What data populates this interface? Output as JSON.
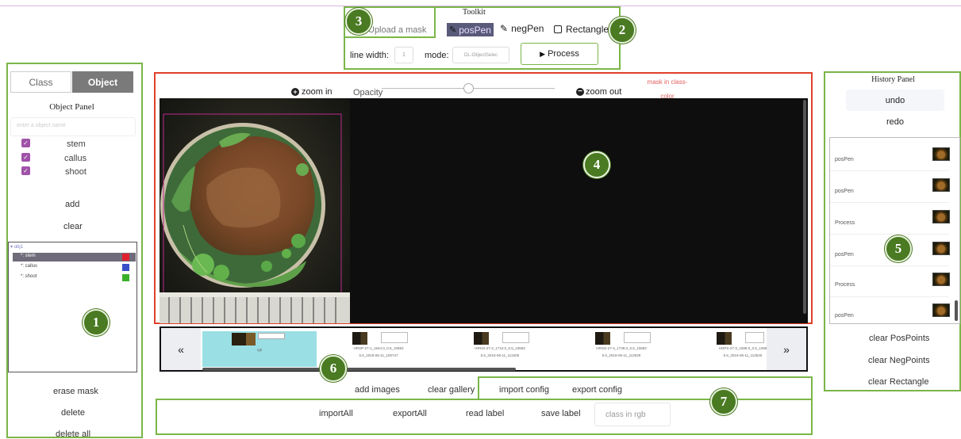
{
  "toolkit": {
    "title": "Toolkit",
    "upload_mask": "Upload a mask",
    "pos_pen": "posPen",
    "neg_pen": "negPen",
    "rectangle": "Rectangle",
    "line_width_label": "line width:",
    "line_width_value": "1",
    "mode_label": "mode:",
    "mode_value": "DL-ObjectSelec",
    "process": "Process"
  },
  "left_panel": {
    "tabs": [
      "Class",
      "Object"
    ],
    "active_tab": "Object",
    "panel_title": "Object Panel",
    "name_placeholder": "enter a object name",
    "classes": [
      {
        "label": "stem",
        "checked": true
      },
      {
        "label": "callus",
        "checked": true
      },
      {
        "label": "shoot",
        "checked": true
      }
    ],
    "add": "add",
    "clear": "clear",
    "tree": {
      "root": "obj1",
      "items": [
        {
          "label": "*: stem",
          "color": "#e0202e",
          "selected": true
        },
        {
          "label": "*: callus",
          "color": "#3850c8",
          "selected": false
        },
        {
          "label": "*: shoot",
          "color": "#3ab02a",
          "selected": false
        }
      ]
    },
    "erase_mask": "erase mask",
    "delete": "delete",
    "delete_all": "delete all"
  },
  "canvas": {
    "zoom_in": "zoom in",
    "opacity_label": "Opacity",
    "zoom_out": "zoom out",
    "mask_label_line1": "mask in class-",
    "mask_label_line2": "color",
    "opacity_level": 0.5
  },
  "gallery": {
    "prev": "«",
    "next": "»",
    "items": [
      {
        "caption1": "rgb",
        "caption2": ""
      },
      {
        "caption1": "HRSP-27-1_1944.0_0.5_10683",
        "caption2": "5.5_2018-06-11_100747"
      },
      {
        "caption1": "HRSO-27-4_1710.0_0.5_10683",
        "caption2": "5.5_2018-06-11_113405"
      },
      {
        "caption1": "HRSO-27-4_1739.0_0.5_10683",
        "caption2": "5.5_2018-06-11_113028"
      },
      {
        "caption1": "HOPS-27-3_1698.0_0.5_1068",
        "caption2": "5.5_2018-06-11_113530"
      }
    ]
  },
  "bottom": {
    "add_images": "add images",
    "clear_gallery": "clear gallery",
    "import_config": "import config",
    "export_config": "export config",
    "import_all": "importAll",
    "export_all": "exportAll",
    "read_label": "read label",
    "save_label": "save label",
    "rgb_placeholder": "class in rgb"
  },
  "history": {
    "title": "History Panel",
    "undo": "undo",
    "redo": "redo",
    "items": [
      "posPen",
      "posPen",
      "Process",
      "posPen",
      "Process",
      "posPen"
    ],
    "clear_pos": "clear PosPoints",
    "clear_neg": "clear NegPoints",
    "clear_rect": "clear Rectangle"
  },
  "markers": [
    "1",
    "2",
    "3",
    "4",
    "5",
    "6",
    "7"
  ],
  "colors": {
    "annotation_green": "#7ab648",
    "marker_green": "#4a7a22",
    "canvas_border": "#e0402a",
    "selected_tab": "#7a7a7a",
    "gallery_selected": "#9adfe4",
    "checkbox": "#a052a8"
  }
}
